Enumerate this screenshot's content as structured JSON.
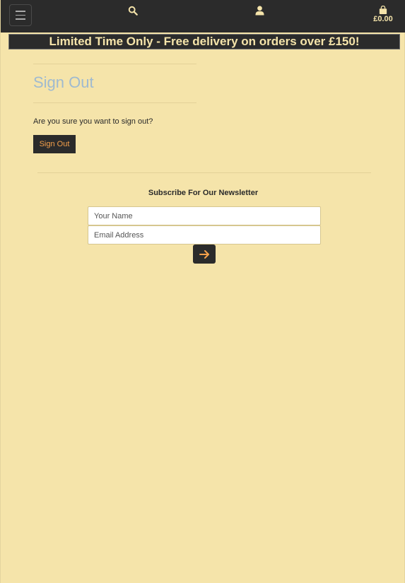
{
  "header": {
    "menu_icon": "hamburger-icon",
    "search_icon": "search-icon",
    "account_icon": "user-icon",
    "cart_icon": "shopping-bag-icon",
    "cart_total": "£0.00"
  },
  "banner": {
    "text": "Limited Time Only - Free delivery on orders over £150!"
  },
  "main": {
    "title": "Sign Out",
    "confirm_text": "Are you sure you want to sign out?",
    "signout_label": "Sign Out"
  },
  "newsletter": {
    "title": "Subscribe For Our Newsletter",
    "name_placeholder": "Your Name",
    "email_placeholder": "Email Address",
    "submit_icon": "arrow-right-icon"
  },
  "colors": {
    "background": "#f5e4aa",
    "dark": "#2b2b2b",
    "accent": "#f5a04b",
    "title": "#9fbad0"
  }
}
